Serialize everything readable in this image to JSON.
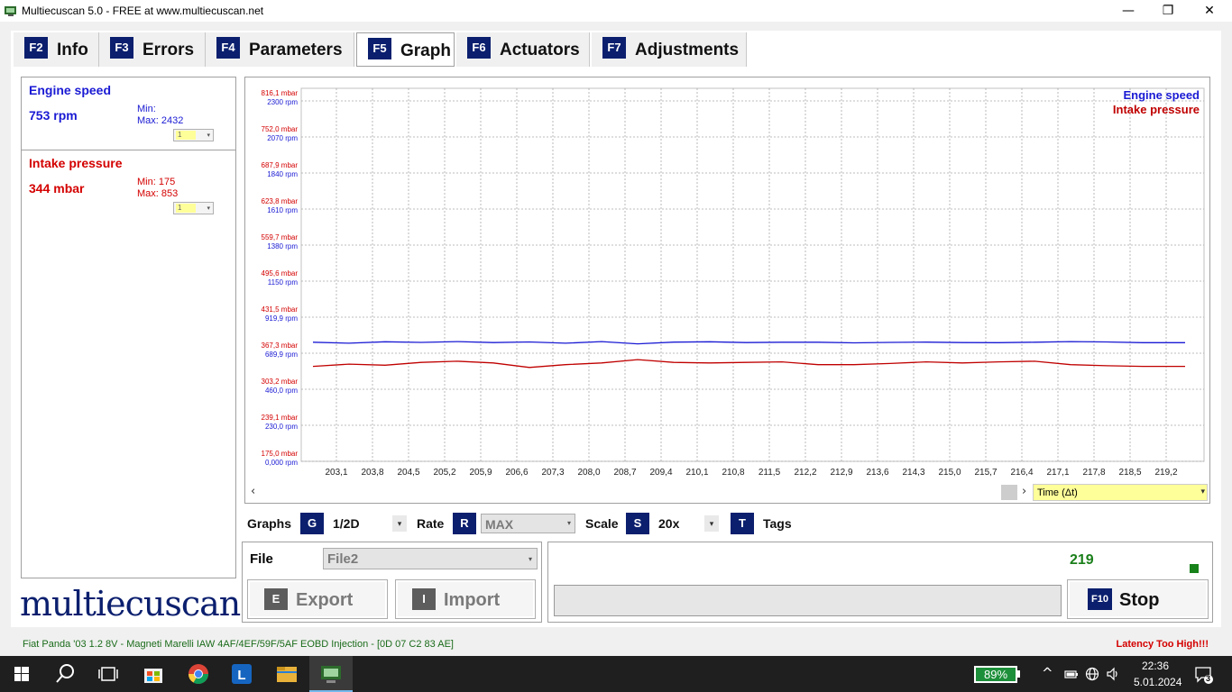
{
  "window": {
    "title": "Multiecuscan 5.0 - FREE at www.multiecuscan.net",
    "minimize_glyph": "—",
    "maximize_glyph": "❐",
    "close_glyph": "✕"
  },
  "tabs": [
    {
      "key": "F2",
      "label": "Info"
    },
    {
      "key": "F3",
      "label": "Errors"
    },
    {
      "key": "F4",
      "label": "Parameters"
    },
    {
      "key": "F5",
      "label": "Graph",
      "active": true
    },
    {
      "key": "F6",
      "label": "Actuators"
    },
    {
      "key": "F7",
      "label": "Adjustments"
    }
  ],
  "parameters": [
    {
      "name": "Engine speed",
      "value": "753 rpm",
      "min": "Min:",
      "max": "Max: 2432",
      "select": "1",
      "color": "#1a1ad4"
    },
    {
      "name": "Intake pressure",
      "value": "344 mbar",
      "min": "Min: 175",
      "max": "Max: 853",
      "select": "1",
      "color": "#d40000"
    }
  ],
  "logo": "multiecuscan",
  "chart_data": {
    "type": "line",
    "x": [
      "203,1",
      "203,8",
      "204,5",
      "205,2",
      "205,9",
      "206,6",
      "207,3",
      "208,0",
      "208,7",
      "209,4",
      "210,1",
      "210,8",
      "211,5",
      "212,2",
      "212,9",
      "213,6",
      "214,3",
      "215,0",
      "215,7",
      "216,4",
      "217,1",
      "217,8",
      "218,5",
      "219,2"
    ],
    "y_ticks_pressure": [
      "816,1 mbar",
      "752,0 mbar",
      "687,9 mbar",
      "623,8 mbar",
      "559,7 mbar",
      "495,6 mbar",
      "431,5 mbar",
      "367,3 mbar",
      "303,2 mbar",
      "239,1 mbar",
      "175,0 mbar"
    ],
    "y_ticks_rpm": [
      "2300 rpm",
      "2070 rpm",
      "1840 rpm",
      "1610 rpm",
      "1380 rpm",
      "1150 rpm",
      "919,9 rpm",
      "689,9 rpm",
      "460,0 rpm",
      "230,0 rpm",
      "0,000 rpm"
    ],
    "y_range_rpm": [
      0,
      2300
    ],
    "y_range_pressure": [
      175.0,
      816.1
    ],
    "grid": true,
    "legend_position": "top-right",
    "series": [
      {
        "name": "Engine speed",
        "color": "#1a1ad4",
        "axis": "rpm",
        "values": [
          760,
          754,
          763,
          759,
          764,
          758,
          762,
          754,
          764,
          750,
          761,
          763,
          758,
          760,
          760,
          756,
          759,
          761,
          758,
          757,
          760,
          764,
          762,
          757
        ]
      },
      {
        "name": "Intake pressure",
        "color": "#c00000",
        "axis": "pressure",
        "values": [
          344,
          348,
          346,
          351,
          353,
          350,
          342,
          347,
          350,
          356,
          351,
          350,
          351,
          352,
          347,
          347,
          349,
          352,
          350,
          352,
          353,
          347,
          345,
          344
        ]
      }
    ]
  },
  "time_select": "Time (Δt)",
  "controls": {
    "graphs_label": "Graphs",
    "graphs_key": "G",
    "graphs_value": "1/2D",
    "rate_label": "Rate",
    "rate_key": "R",
    "rate_value": "MAX",
    "scale_label": "Scale",
    "scale_key": "S",
    "scale_value": "20x",
    "tags_key": "T",
    "tags_label": "Tags",
    "dropdown_glyph": "▾"
  },
  "file": {
    "label": "File",
    "value": "File2",
    "export_key": "E",
    "export_label": "Export",
    "import_key": "I",
    "import_label": "Import"
  },
  "status": {
    "counter": "219",
    "stop_key": "F10",
    "stop_label": "Stop"
  },
  "statusbar": {
    "vehicle": "Fiat Panda '03 1.2 8V - Magneti Marelli IAW 4AF/4EF/59F/5AF EOBD Injection - [0D 07 C2 83 AE]",
    "latency": "Latency Too High!!!"
  },
  "taskbar": {
    "battery": "89%",
    "time": "22:36",
    "date": "5.01.2024",
    "notifications": "3"
  }
}
